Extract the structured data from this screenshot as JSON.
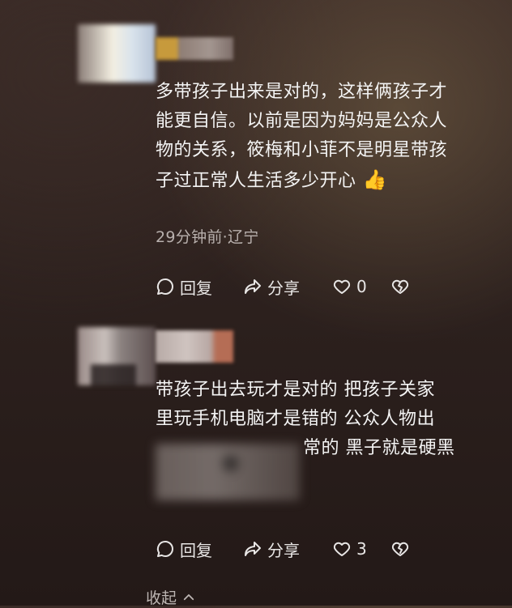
{
  "comments": [
    {
      "text_lines": [
        "多带孩子出来是对的，这样俩孩子才",
        "能更自信。以前是因为妈妈是公众人",
        "物的关系，筱梅和小菲不是明星带孩",
        "子过正常人生活多少开心"
      ],
      "emoji": "👍",
      "meta": "29分钟前·辽宁",
      "reply_label": "回复",
      "share_label": "分享",
      "like_count": "0"
    },
    {
      "text_lines": [
        "带孩子出去玩才是对的 把孩子关家",
        "里玩手机电脑才是错的 公众人物出",
        "常的 黑子就是硬黑"
      ],
      "reply_label": "回复",
      "share_label": "分享",
      "like_count": "3"
    }
  ],
  "collapse_label": "收起",
  "icons": {
    "reply": "speech-bubble-icon",
    "share": "share-arrow-icon",
    "like": "heart-icon",
    "dislike": "broken-heart-icon",
    "collapse": "chevron-up-icon"
  }
}
